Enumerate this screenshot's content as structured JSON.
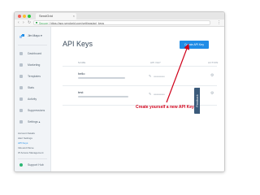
{
  "browser": {
    "tab_title": "SendGrid",
    "tab_close": "×",
    "url_secure_label": "Secure",
    "url": "https://app.sendgrid.com/settings/api_keys",
    "menu_label": "⋮"
  },
  "sidebar": {
    "account": "Jim Mayo ▾",
    "nav": [
      {
        "label": "Dashboard",
        "icon": "dashboard-icon"
      },
      {
        "label": "Marketing",
        "icon": "marketing-icon"
      },
      {
        "label": "Templates",
        "icon": "templates-icon"
      },
      {
        "label": "Stats",
        "icon": "stats-icon"
      },
      {
        "label": "Activity",
        "icon": "activity-icon"
      },
      {
        "label": "Suppressions",
        "icon": "suppressions-icon"
      },
      {
        "label": "Settings ▴",
        "icon": "settings-icon"
      }
    ],
    "settings_sub": [
      "Account Details",
      "Alert Settings",
      "API Keys",
      "Inbound Parse",
      "IP Access Management"
    ],
    "support": "Support Hub"
  },
  "main": {
    "title": "API Keys",
    "create_button": "Create API Key",
    "columns": {
      "name": "NAME",
      "key": "API KEY",
      "action": "ACTION"
    },
    "rows": [
      {
        "name": "hello",
        "key_mask": "••••••••••••••••••"
      },
      {
        "name": "test",
        "key_mask": "••••••••••••••••••"
      }
    ],
    "feedback": "Feedback"
  },
  "annotation": {
    "text": "Create yourself a new API Key",
    "color": "#d0021b"
  },
  "colors": {
    "accent": "#1f8ce6",
    "sidebar_bg": "#f1f4f7",
    "feedback_bg": "#3b5a7a"
  }
}
